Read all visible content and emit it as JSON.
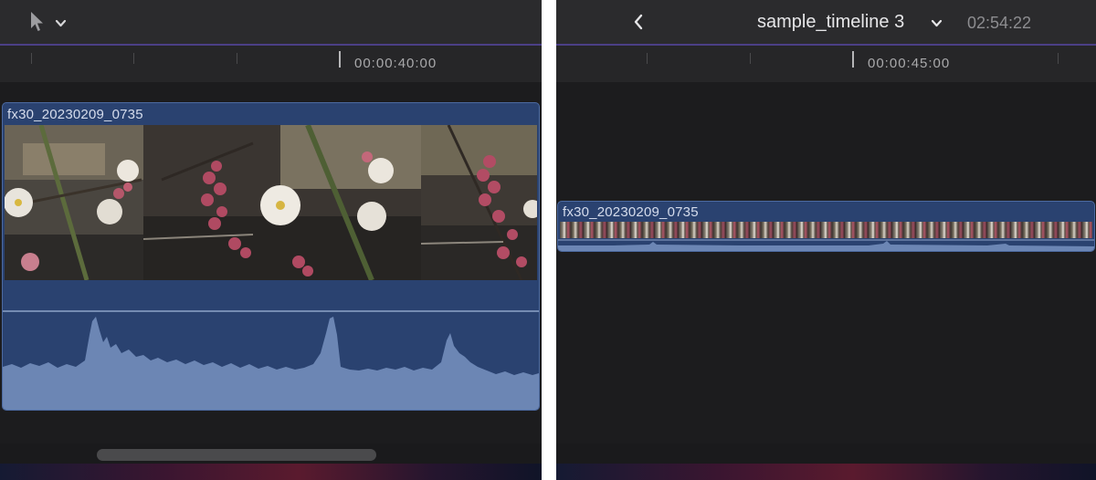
{
  "left": {
    "toolbar": {
      "tool_icon": "pointer-arrow-icon",
      "tool_menu_icon": "chevron-down-icon"
    },
    "ruler": {
      "timecode": "00:00:40:00"
    },
    "clip": {
      "name": "fx30_20230209_0735"
    }
  },
  "right": {
    "toolbar": {
      "back_icon": "chevron-left-icon",
      "timeline_name": "sample_timeline 3",
      "timeline_menu_icon": "chevron-down-icon",
      "duration": "02:54:22"
    },
    "ruler": {
      "timecode": "00:00:45:00"
    },
    "clip": {
      "name": "fx30_20230209_0735"
    }
  },
  "colors": {
    "panel_bg": "#1c1c1e",
    "toolbar_bg": "#2b2b2d",
    "clip_bg": "#2a4270",
    "waveform": "#6c86b4",
    "playhead_accent": "#4b3f86"
  }
}
